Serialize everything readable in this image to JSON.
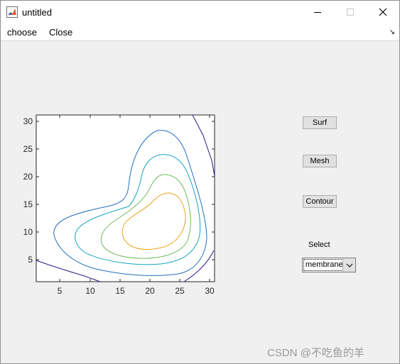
{
  "window": {
    "title": "untitled",
    "icon": "matlab-icon"
  },
  "menu": {
    "items": [
      "choose",
      "Close"
    ]
  },
  "axes": {
    "x_ticks": [
      "5",
      "10",
      "15",
      "20",
      "25",
      "30"
    ],
    "y_ticks": [
      "30",
      "25",
      "20",
      "15",
      "10",
      "5"
    ]
  },
  "chart_data": {
    "type": "contour",
    "xlim": [
      1,
      31
    ],
    "ylim": [
      1,
      31
    ],
    "x_ticks": [
      5,
      10,
      15,
      20,
      25,
      30
    ],
    "y_ticks": [
      5,
      10,
      15,
      20,
      25,
      30
    ],
    "colormap": [
      "#2a1a8a",
      "#1f6fc1",
      "#14a5bd",
      "#6fbb5a",
      "#e8a51e"
    ]
  },
  "buttons": {
    "surf": "Surf",
    "mesh": "Mesh",
    "contour": "Contour"
  },
  "select": {
    "label": "Select",
    "value": "membrane"
  },
  "watermark": "CSDN @不吃鱼的羊"
}
